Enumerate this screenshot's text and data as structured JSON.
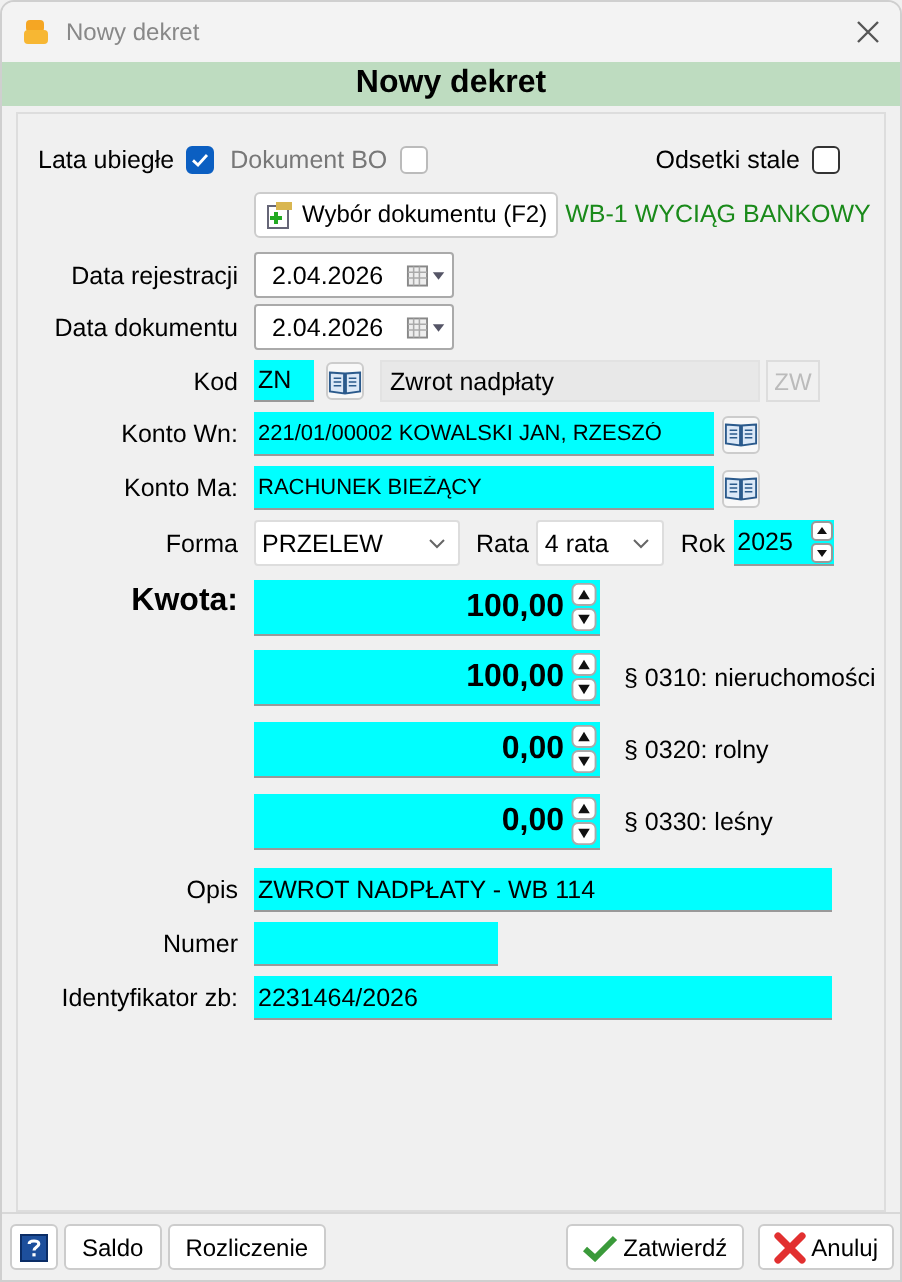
{
  "window": {
    "title": "Nowy dekret"
  },
  "header": "Nowy dekret",
  "options": [
    {
      "label": "Lata ubiegłe",
      "checked": true,
      "disabled": false
    },
    {
      "label": "Dokument BO",
      "checked": false,
      "disabled": true
    },
    {
      "label": "Odsetki stale",
      "checked": false,
      "disabled": false
    }
  ],
  "document_button": "Wybór dokumentu (F2)",
  "document_name": "WB-1 WYCIĄG BANKOWY",
  "dates": [
    {
      "label": "Data rejestracji",
      "value": "2.04.2026"
    },
    {
      "label": "Data dokumentu",
      "value": "2.04.2026"
    }
  ],
  "kod": {
    "label": "Kod",
    "value": "ZN",
    "name": "Zwrot nadpłaty",
    "button": "ZW",
    "button_disabled": true
  },
  "accounts": [
    {
      "label": "Konto Wn:",
      "value": "221/01/00002 KOWALSKI JAN, RZESZÓ"
    },
    {
      "label": "Konto Ma:",
      "value": "RACHUNEK BIEŻĄCY"
    }
  ],
  "forma": {
    "label": "Forma",
    "value": "PRZELEW"
  },
  "rata": {
    "label": "Rata",
    "value": "4 rata"
  },
  "rok": {
    "label": "Rok",
    "value": "2025"
  },
  "amount": {
    "label": "Kwota:",
    "value": "100,00"
  },
  "splits": [
    {
      "value": "100,00",
      "label": "§ 0310: nieruchomości"
    },
    {
      "value": "0,00",
      "label": "§ 0320: rolny"
    },
    {
      "value": "0,00",
      "label": "§ 0330: leśny"
    }
  ],
  "text_fields": [
    {
      "label": "Opis",
      "value": "ZWROT NADPŁATY - WB 114",
      "wide": true
    },
    {
      "label": "Numer",
      "wide": false
    },
    {
      "label": "Identyfikator zb:",
      "value": "2231464/2026",
      "wide": true
    }
  ],
  "footer": {
    "left_buttons": [
      "Saldo",
      "Rozliczenie"
    ],
    "right_buttons": [
      {
        "kind": "confirm",
        "label": "Zatwierdź"
      },
      {
        "kind": "cancel",
        "label": "Anuluj"
      }
    ]
  }
}
